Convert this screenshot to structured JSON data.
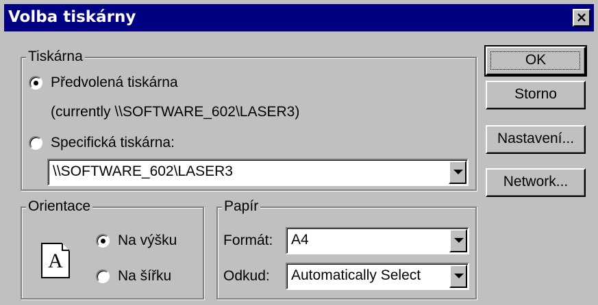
{
  "window": {
    "title": "Volba tiskárny",
    "close_label": "×"
  },
  "printer": {
    "group_label": "Tiskárna",
    "default_option": "Předvolená tiskárna",
    "default_selected": true,
    "currently_text": "(currently \\\\SOFTWARE_602\\LASER3)",
    "specific_option": "Specifická tiskárna:",
    "specific_selected": false,
    "specific_value": "\\\\SOFTWARE_602\\LASER3"
  },
  "orientation": {
    "group_label": "Orientace",
    "icon_letter": "A",
    "portrait_option": "Na výšku",
    "portrait_selected": true,
    "landscape_option": "Na šířku",
    "landscape_selected": false
  },
  "paper": {
    "group_label": "Papír",
    "format_label": "Formát:",
    "format_value": "A4",
    "source_label": "Odkud:",
    "source_value": "Automatically Select"
  },
  "buttons": {
    "ok": "OK",
    "cancel": "Storno",
    "setup": "Nastavení...",
    "network": "Network..."
  }
}
